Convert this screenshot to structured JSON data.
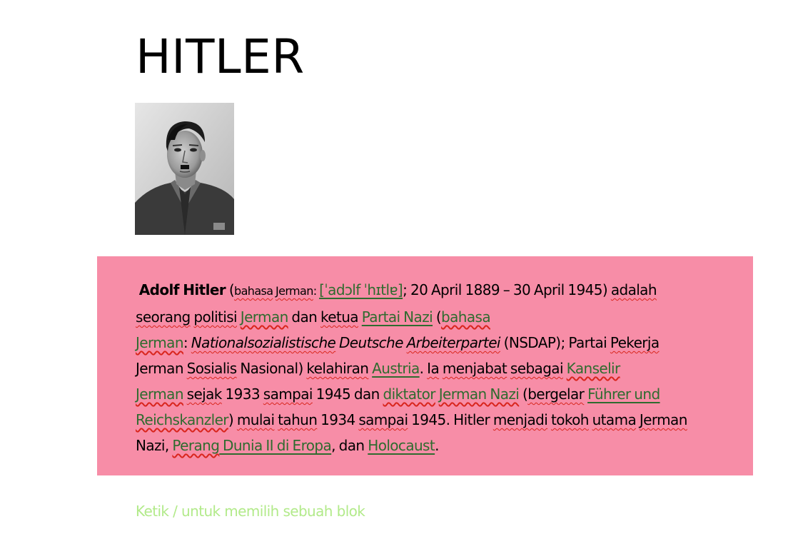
{
  "document": {
    "title": "HITLER",
    "portrait_alt": "Adolf Hitler portrait",
    "block_color": "#f78da7",
    "link_color": "#2f6b2f",
    "spellcheck_color": "#d9251d",
    "placeholder_color": "#b2ea8a"
  },
  "paragraph": {
    "t01": "Adolf Hitler",
    "t02": " (",
    "t03": "bahasa",
    "t04": " ",
    "t05": "Jerman",
    "t06": ": ",
    "t07": "[ˈadɔlf ˈhɪtlɐ]",
    "t08": "; 20 April 1889 – 30 April 1945) ",
    "t09": "adalah",
    "t10": "seorang",
    "t11": " ",
    "t12": "politisi",
    "t13": " ",
    "t14": "Jerman",
    "t15": " dan ",
    "t16": "ketua",
    "t17": " ",
    "t18": "Partai Nazi",
    "t19": " (",
    "t20": "bahasa",
    "t21": "Jerman",
    "t22": ": ",
    "t23": "Nationalsozialistische",
    "t24": " Deutsche ",
    "t25": "Arbeiterpartei",
    "t26": " (NSDAP); Partai ",
    "t27": "Pekerja",
    "t28": "Jerman ",
    "t29": "Sosialis",
    "t30": " Nasional) ",
    "t31": "kelahiran",
    "t32": " ",
    "t33": "Austria",
    "t34": ". ",
    "t35": "Ia",
    "t36": " ",
    "t37": "menjabat",
    "t38": " ",
    "t39": "sebagai",
    "t40": " ",
    "t41": "Kanselir",
    "t42": "Jerman",
    "t43": " ",
    "t44": "sejak",
    "t45": " 1933 ",
    "t46": "sampai",
    "t47": " 1945 dan ",
    "t48": "diktator",
    "t49": " ",
    "t50": "Jerman Nazi",
    "t51": " (",
    "t52": "bergelar",
    "t53": " ",
    "t54": "Führer und",
    "t55": "Reichskanzler",
    "t56": ") ",
    "t57": "mulai",
    "t58": " ",
    "t59": "tahun",
    "t60": " 1934 ",
    "t61": "sampai",
    "t62": " 1945. Hitler ",
    "t63": "menjadi",
    "t64": " ",
    "t65": "tokoh",
    "t66": " ",
    "t67": "utama",
    "t68": " ",
    "t69": "Jerman",
    "t70": "Nazi, ",
    "t71": "Perang",
    "t72": " Dunia II di Eropa",
    "t73": ", dan ",
    "t74": "Holocaust",
    "t75": "."
  },
  "editor": {
    "placeholder": "Ketik / untuk memilih sebuah blok"
  }
}
